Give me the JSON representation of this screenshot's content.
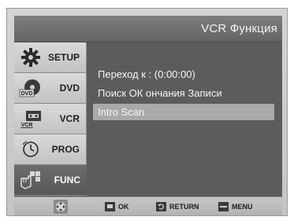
{
  "header": {
    "title": "VCR Функция"
  },
  "sidebar": {
    "items": [
      {
        "label": "SETUP",
        "icon": "gear-icon",
        "active": false
      },
      {
        "label": "DVD",
        "icon": "dvd-disc-icon",
        "icon_text": "DVD",
        "active": false
      },
      {
        "label": "VCR",
        "icon": "vcr-cassette-icon",
        "icon_text": "VCR",
        "active": false
      },
      {
        "label": "PROG",
        "icon": "clock-icon",
        "active": false
      },
      {
        "label": "FUNC",
        "icon": "remote-hand-icon",
        "active": true
      }
    ]
  },
  "menu": {
    "items": [
      {
        "label": "Переход к : (0:00:00)",
        "selected": false
      },
      {
        "label": "Поиск ОК ончания Записи",
        "selected": false
      },
      {
        "label": "Intro Scan",
        "selected": true
      }
    ]
  },
  "footer": {
    "nav_icon": "directional-pad-icon",
    "ok_label": "OK",
    "return_label": "RETURN",
    "menu_label": "MENU"
  },
  "colors": {
    "header_bg": "#707070",
    "content_bg": "#5c5c5c",
    "selected_row": "#a9a9a9",
    "sidebar_inactive": "#cfcfcf",
    "sidebar_active": "#616161"
  }
}
